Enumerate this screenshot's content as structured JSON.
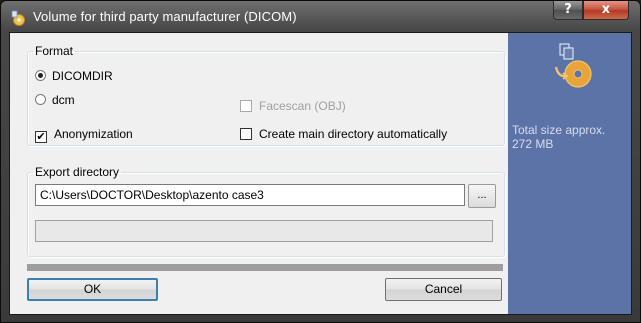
{
  "window": {
    "title": "Volume for third party manufacturer (DICOM)",
    "help_label": "?",
    "close_label": "x"
  },
  "format": {
    "legend": "Format",
    "options": [
      {
        "label": "DICOMDIR",
        "selected": true
      },
      {
        "label": "dcm",
        "selected": false
      }
    ],
    "facescan": {
      "label": "Facescan (OBJ)",
      "checked": false,
      "enabled": false
    },
    "anonymization": {
      "label": "Anonymization",
      "checked": true
    },
    "create_main_dir": {
      "label": "Create main directory automatically",
      "checked": false
    }
  },
  "export": {
    "legend": "Export directory",
    "path_value": "C:\\Users\\DOCTOR\\Desktop\\azento case3",
    "browse_label": "...",
    "progress": 0
  },
  "side_panel": {
    "total_label_line1": "Total size approx.",
    "total_value": "272 MB",
    "background_color": "#5c73a8"
  },
  "buttons": {
    "ok_label": "OK",
    "cancel_label": "Cancel"
  }
}
